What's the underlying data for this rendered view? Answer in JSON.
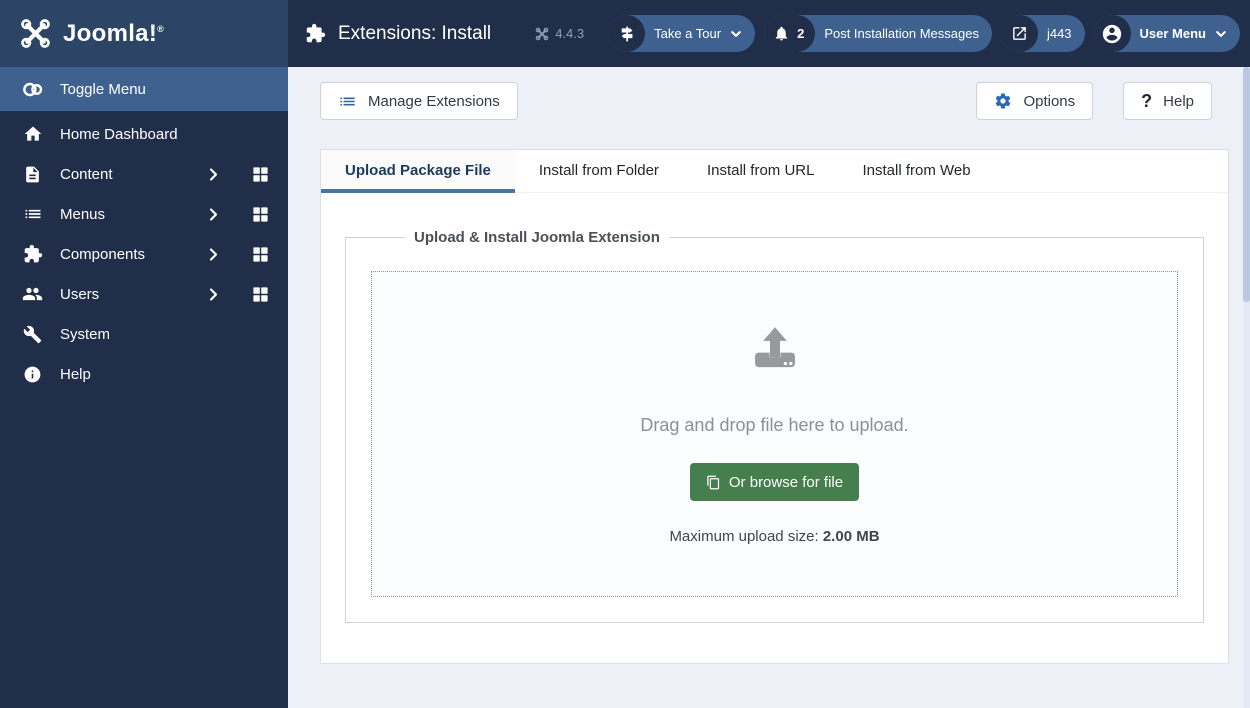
{
  "brand": {
    "logo_text": "Joomla!",
    "trademark": "®"
  },
  "header": {
    "title": "Extensions: Install",
    "version": "4.4.3",
    "pills": {
      "tour": {
        "label": "Take a Tour"
      },
      "messages": {
        "label": "Post Installation Messages",
        "badge": "2"
      },
      "site": {
        "label": "j443"
      },
      "user": {
        "label": "User Menu"
      }
    }
  },
  "sidebar": {
    "toggle_label": "Toggle Menu",
    "items": [
      {
        "label": "Home Dashboard"
      },
      {
        "label": "Content"
      },
      {
        "label": "Menus"
      },
      {
        "label": "Components"
      },
      {
        "label": "Users"
      },
      {
        "label": "System"
      },
      {
        "label": "Help"
      }
    ]
  },
  "toolbar": {
    "manage": "Manage Extensions",
    "options": "Options",
    "help": "Help",
    "help_icon": "?"
  },
  "tabs": [
    {
      "label": "Upload Package File"
    },
    {
      "label": "Install from Folder"
    },
    {
      "label": "Install from URL"
    },
    {
      "label": "Install from Web"
    }
  ],
  "upload_panel": {
    "legend": "Upload & Install Joomla Extension",
    "dropzone_text": "Drag and drop file here to upload.",
    "browse_label": "Or browse for file",
    "max_upload_label": "Maximum upload size:",
    "max_upload_value": "2.00 MB"
  },
  "colors": {
    "header_bg": "#212e4a",
    "logo_block_bg": "#2c4466",
    "highlight_bg": "#3f6190",
    "accent_blue": "#2a69b8",
    "tab_underline": "#4b73a1",
    "success_green": "#457f4e",
    "page_bg": "#edf0f6"
  }
}
